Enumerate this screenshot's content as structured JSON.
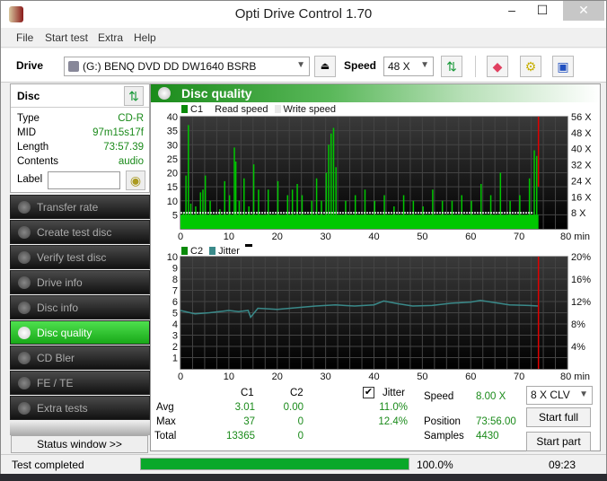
{
  "window": {
    "title": "Opti Drive Control 1.70",
    "minimize": "‒",
    "maximize": "☐",
    "close": "✕"
  },
  "menu": [
    "File",
    "Start test",
    "Extra",
    "Help"
  ],
  "toolbar": {
    "drive_label": "Drive",
    "drive_value": "(G:)  BENQ DVD DD DW1640 BSRB",
    "speed_label": "Speed",
    "speed_value": "48 X",
    "icons": [
      "eject-icon",
      "refresh-icon",
      "erase-icon",
      "settings-icon",
      "save-icon"
    ]
  },
  "disc": {
    "title": "Disc",
    "fields": [
      {
        "label": "Type",
        "value": "CD-R"
      },
      {
        "label": "MID",
        "value": "97m15s17f"
      },
      {
        "label": "Length",
        "value": "73:57.39"
      },
      {
        "label": "Contents",
        "value": "audio"
      }
    ],
    "label_label": "Label",
    "label_value": ""
  },
  "nav": [
    {
      "label": "Transfer rate",
      "active": false
    },
    {
      "label": "Create test disc",
      "active": false
    },
    {
      "label": "Verify test disc",
      "active": false
    },
    {
      "label": "Drive info",
      "active": false
    },
    {
      "label": "Disc info",
      "active": false
    },
    {
      "label": "Disc quality",
      "active": true
    },
    {
      "label": "CD Bler",
      "active": false
    },
    {
      "label": "FE / TE",
      "active": false
    },
    {
      "label": "Extra tests",
      "active": false
    }
  ],
  "status_window_label": "Status window >>",
  "panel": {
    "title": "Disc quality"
  },
  "stats": {
    "col_c1": "C1",
    "col_c2": "C2",
    "jitter_label": "Jitter",
    "jitter_checked": true,
    "rows": [
      {
        "label": "Avg",
        "c1": "3.01",
        "c2": "0.00",
        "jitter": "11.0%"
      },
      {
        "label": "Max",
        "c1": "37",
        "c2": "0",
        "jitter": "12.4%"
      },
      {
        "label": "Total",
        "c1": "13365",
        "c2": "0",
        "jitter": ""
      }
    ],
    "speed_label": "Speed",
    "speed_value": "8.00 X",
    "position_label": "Position",
    "position_value": "73:56.00",
    "samples_label": "Samples",
    "samples_value": "4430"
  },
  "controls": {
    "speed_select": "8 X CLV",
    "start_full": "Start full",
    "start_part": "Start part"
  },
  "statusbar": {
    "text": "Test completed",
    "progress": 100.0,
    "progress_text": "100.0%",
    "time": "09:23"
  },
  "colors": {
    "accent": "#1b8b1b",
    "c1": "#00c800",
    "jitter": "#3a8a8a",
    "marker": "#e00000"
  },
  "chart_data": [
    {
      "type": "bar",
      "title": "C1",
      "legend": [
        "C1",
        "Read speed",
        "Write speed"
      ],
      "legend_position": "top-left",
      "xlabel": "min",
      "x_ticks": [
        "0",
        "10",
        "20",
        "30",
        "40",
        "50",
        "60",
        "70",
        "80 min"
      ],
      "xlim": [
        0,
        80
      ],
      "ylim": [
        0,
        40
      ],
      "y_ticks": [
        "5",
        "10",
        "15",
        "20",
        "25",
        "30",
        "35",
        "40"
      ],
      "y2_ticks": [
        "8 X",
        "16 X",
        "24 X",
        "32 X",
        "40 X",
        "48 X",
        "56 X"
      ],
      "y2lim": [
        0,
        56
      ],
      "end_marker_min": 74,
      "series": [
        {
          "name": "C1",
          "peaks": [
            [
              0.5,
              6
            ],
            [
              1,
              19
            ],
            [
              1.5,
              37
            ],
            [
              2,
              9
            ],
            [
              3,
              8
            ],
            [
              4,
              13
            ],
            [
              4.5,
              14
            ],
            [
              5,
              19
            ],
            [
              6,
              10
            ],
            [
              8,
              7
            ],
            [
              9,
              17
            ],
            [
              10,
              12
            ],
            [
              11,
              29
            ],
            [
              11.3,
              24
            ],
            [
              12,
              10
            ],
            [
              13,
              18
            ],
            [
              14,
              8
            ],
            [
              15,
              23
            ],
            [
              16,
              14
            ],
            [
              18,
              14
            ],
            [
              20,
              17
            ],
            [
              22,
              12
            ],
            [
              23,
              14
            ],
            [
              24,
              16
            ],
            [
              25,
              12
            ],
            [
              27,
              10
            ],
            [
              28,
              18
            ],
            [
              29,
              10
            ],
            [
              30,
              20
            ],
            [
              30.5,
              30
            ],
            [
              31,
              34
            ],
            [
              31.5,
              36
            ],
            [
              32,
              22
            ],
            [
              34,
              10
            ],
            [
              36,
              12
            ],
            [
              38,
              14
            ],
            [
              40,
              10
            ],
            [
              42,
              12
            ],
            [
              44,
              8
            ],
            [
              46,
              12
            ],
            [
              48,
              10
            ],
            [
              50,
              8
            ],
            [
              52,
              14
            ],
            [
              54,
              10
            ],
            [
              56,
              10
            ],
            [
              58,
              12
            ],
            [
              60,
              10
            ],
            [
              62,
              16
            ],
            [
              64,
              12
            ],
            [
              66,
              20
            ],
            [
              68,
              10
            ],
            [
              70,
              12
            ],
            [
              72,
              18
            ],
            [
              73,
              28
            ],
            [
              73.5,
              26
            ]
          ],
          "baseline": 5
        },
        {
          "name": "Read speed",
          "value_x": 8
        }
      ]
    },
    {
      "type": "line",
      "title": "C2 / Jitter",
      "legend": [
        "C2",
        "Jitter"
      ],
      "legend_position": "top-left",
      "xlabel": "min",
      "x_ticks": [
        "0",
        "10",
        "20",
        "30",
        "40",
        "50",
        "60",
        "70",
        "80 min"
      ],
      "xlim": [
        0,
        80
      ],
      "ylim": [
        0,
        10
      ],
      "y_ticks": [
        "1",
        "2",
        "3",
        "4",
        "5",
        "6",
        "7",
        "8",
        "9",
        "10"
      ],
      "y2_ticks": [
        "4%",
        "8%",
        "12%",
        "16%",
        "20%"
      ],
      "y2lim": [
        0,
        20
      ],
      "end_marker_min": 74,
      "series": [
        {
          "name": "C2",
          "x": [
            0,
            74
          ],
          "y": [
            0,
            0
          ]
        },
        {
          "name": "Jitter",
          "x": [
            0,
            3,
            6,
            10,
            12,
            14,
            14.5,
            16,
            20,
            24,
            28,
            32,
            36,
            40,
            42,
            45,
            48,
            52,
            56,
            60,
            62,
            65,
            68,
            72,
            74
          ],
          "y": [
            10.4,
            9.8,
            10.0,
            10.4,
            10.2,
            10.4,
            9.2,
            10.8,
            10.6,
            10.9,
            11.2,
            11.4,
            11.2,
            11.4,
            12.1,
            11.6,
            11.2,
            11.3,
            11.7,
            11.9,
            12.2,
            11.8,
            11.4,
            11.3,
            11.2
          ]
        }
      ]
    }
  ]
}
